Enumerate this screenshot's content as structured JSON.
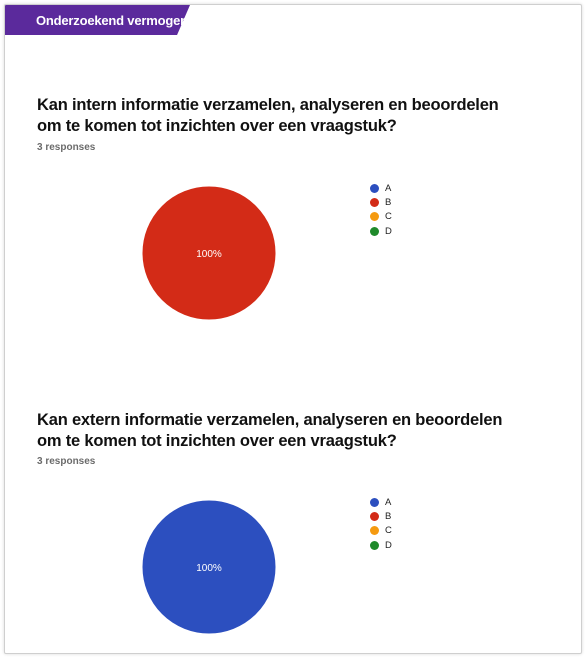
{
  "section": {
    "title": "Onderzoekend vermogen",
    "color": "#5b2a9c"
  },
  "chart_data": [
    {
      "type": "pie",
      "title": "Kan intern informatie verzamelen, analyseren en beoordelen om te komen tot inzichten over een vraagstuk?",
      "subtitle": "3 responses",
      "categories": [
        "A",
        "B",
        "C",
        "D"
      ],
      "values": [
        0,
        3,
        0,
        0
      ],
      "colors": [
        "#2c4fbf",
        "#d32b17",
        "#f59a10",
        "#1f8a2b"
      ],
      "data_labels": [
        "",
        "100%",
        "",
        ""
      ],
      "legend": "right"
    },
    {
      "type": "pie",
      "title": "Kan extern informatie verzamelen, analyseren en beoordelen om te komen tot inzichten over een vraagstuk?",
      "subtitle": "3 responses",
      "categories": [
        "A",
        "B",
        "C",
        "D"
      ],
      "values": [
        3,
        0,
        0,
        0
      ],
      "colors": [
        "#2c4fbf",
        "#d32b17",
        "#f59a10",
        "#1f8a2b"
      ],
      "data_labels": [
        "100%",
        "",
        "",
        ""
      ],
      "legend": "right"
    }
  ]
}
